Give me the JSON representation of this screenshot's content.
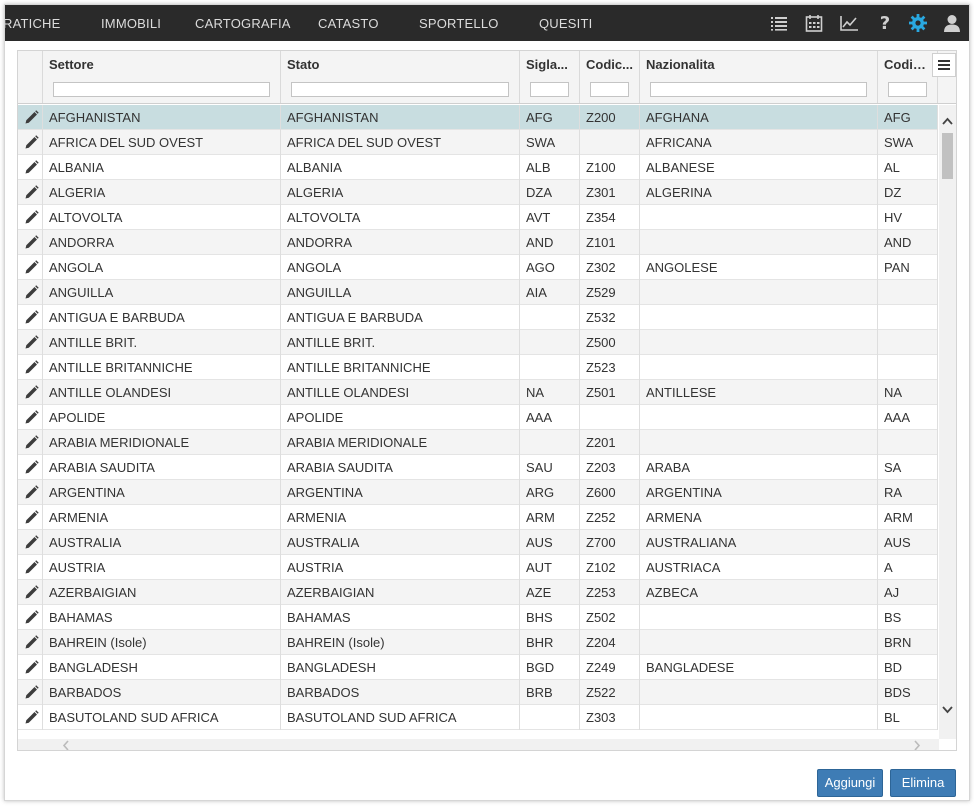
{
  "nav": {
    "items": [
      {
        "label": "RATICHE"
      },
      {
        "label": "IMMOBILI"
      },
      {
        "label": "CARTOGRAFIA"
      },
      {
        "label": "CATASTO"
      },
      {
        "label": "SPORTELLO"
      },
      {
        "label": "QUESITI"
      }
    ],
    "icons": [
      "list-icon",
      "calendar-icon",
      "chart-icon",
      "help-icon",
      "gear-icon",
      "user-icon"
    ],
    "active_icon_color": "#29a8e0"
  },
  "grid": {
    "columns": [
      {
        "title": "."
      },
      {
        "title": "Settore"
      },
      {
        "title": "Stato"
      },
      {
        "title": "Sigla..."
      },
      {
        "title": "Codic..."
      },
      {
        "title": "Nazionalita"
      },
      {
        "title": "Codice..."
      }
    ],
    "selected_row_color": "#c8dde0",
    "rows": [
      {
        "settore": "AFGHANISTAN",
        "stato": "AFGHANISTAN",
        "sigla": "AFG",
        "codice": "Z200",
        "nazionalita": "AFGHANA",
        "codice2": "AFG"
      },
      {
        "settore": "AFRICA DEL SUD OVEST",
        "stato": "AFRICA DEL SUD OVEST",
        "sigla": "SWA",
        "codice": "",
        "nazionalita": "AFRICANA",
        "codice2": "SWA"
      },
      {
        "settore": "ALBANIA",
        "stato": "ALBANIA",
        "sigla": "ALB",
        "codice": "Z100",
        "nazionalita": "ALBANESE",
        "codice2": "AL"
      },
      {
        "settore": "ALGERIA",
        "stato": "ALGERIA",
        "sigla": "DZA",
        "codice": "Z301",
        "nazionalita": "ALGERINA",
        "codice2": "DZ"
      },
      {
        "settore": "ALTOVOLTA",
        "stato": "ALTOVOLTA",
        "sigla": "AVT",
        "codice": "Z354",
        "nazionalita": "",
        "codice2": "HV"
      },
      {
        "settore": "ANDORRA",
        "stato": "ANDORRA",
        "sigla": "AND",
        "codice": "Z101",
        "nazionalita": "",
        "codice2": "AND"
      },
      {
        "settore": "ANGOLA",
        "stato": "ANGOLA",
        "sigla": "AGO",
        "codice": "Z302",
        "nazionalita": "ANGOLESE",
        "codice2": "PAN"
      },
      {
        "settore": "ANGUILLA",
        "stato": "ANGUILLA",
        "sigla": "AIA",
        "codice": "Z529",
        "nazionalita": "",
        "codice2": ""
      },
      {
        "settore": "ANTIGUA E BARBUDA",
        "stato": "ANTIGUA E BARBUDA",
        "sigla": "",
        "codice": "Z532",
        "nazionalita": "",
        "codice2": ""
      },
      {
        "settore": "ANTILLE BRIT.",
        "stato": "ANTILLE BRIT.",
        "sigla": "",
        "codice": "Z500",
        "nazionalita": "",
        "codice2": ""
      },
      {
        "settore": "ANTILLE BRITANNICHE",
        "stato": "ANTILLE BRITANNICHE",
        "sigla": "",
        "codice": "Z523",
        "nazionalita": "",
        "codice2": ""
      },
      {
        "settore": "ANTILLE OLANDESI",
        "stato": "ANTILLE OLANDESI",
        "sigla": "NA",
        "codice": "Z501",
        "nazionalita": "ANTILLESE",
        "codice2": "NA"
      },
      {
        "settore": "APOLIDE",
        "stato": "APOLIDE",
        "sigla": "AAA",
        "codice": "",
        "nazionalita": "",
        "codice2": "AAA"
      },
      {
        "settore": "ARABIA MERIDIONALE",
        "stato": "ARABIA MERIDIONALE",
        "sigla": "",
        "codice": "Z201",
        "nazionalita": "",
        "codice2": ""
      },
      {
        "settore": "ARABIA SAUDITA",
        "stato": "ARABIA SAUDITA",
        "sigla": "SAU",
        "codice": "Z203",
        "nazionalita": "ARABA",
        "codice2": "SA"
      },
      {
        "settore": "ARGENTINA",
        "stato": "ARGENTINA",
        "sigla": "ARG",
        "codice": "Z600",
        "nazionalita": "ARGENTINA",
        "codice2": "RA"
      },
      {
        "settore": "ARMENIA",
        "stato": "ARMENIA",
        "sigla": "ARM",
        "codice": "Z252",
        "nazionalita": "ARMENA",
        "codice2": "ARM"
      },
      {
        "settore": "AUSTRALIA",
        "stato": "AUSTRALIA",
        "sigla": "AUS",
        "codice": "Z700",
        "nazionalita": "AUSTRALIANA",
        "codice2": "AUS"
      },
      {
        "settore": "AUSTRIA",
        "stato": "AUSTRIA",
        "sigla": "AUT",
        "codice": "Z102",
        "nazionalita": "AUSTRIACA",
        "codice2": "A"
      },
      {
        "settore": "AZERBAIGIAN",
        "stato": "AZERBAIGIAN",
        "sigla": "AZE",
        "codice": "Z253",
        "nazionalita": "AZBECA",
        "codice2": "AJ"
      },
      {
        "settore": "BAHAMAS",
        "stato": "BAHAMAS",
        "sigla": "BHS",
        "codice": "Z502",
        "nazionalita": "",
        "codice2": "BS"
      },
      {
        "settore": "BAHREIN (Isole)",
        "stato": "BAHREIN (Isole)",
        "sigla": "BHR",
        "codice": "Z204",
        "nazionalita": "",
        "codice2": "BRN"
      },
      {
        "settore": "BANGLADESH",
        "stato": "BANGLADESH",
        "sigla": "BGD",
        "codice": "Z249",
        "nazionalita": "BANGLADESE",
        "codice2": "BD"
      },
      {
        "settore": "BARBADOS",
        "stato": "BARBADOS",
        "sigla": "BRB",
        "codice": "Z522",
        "nazionalita": "",
        "codice2": "BDS"
      },
      {
        "settore": "BASUTOLAND SUD AFRICA",
        "stato": "BASUTOLAND SUD AFRICA",
        "sigla": "",
        "codice": "Z303",
        "nazionalita": "",
        "codice2": "BL"
      }
    ]
  },
  "buttons": {
    "add_label": "Aggiungi",
    "delete_label": "Elimina",
    "color": "#3e7cb5"
  }
}
